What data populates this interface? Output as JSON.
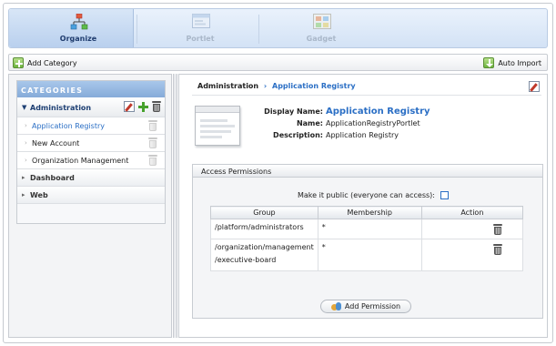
{
  "tabs": [
    {
      "label": "Organize",
      "icon": "organize-icon",
      "active": true
    },
    {
      "label": "Portlet",
      "icon": "portlet-icon",
      "active": false
    },
    {
      "label": "Gadget",
      "icon": "gadget-icon",
      "active": false
    }
  ],
  "toolbar": {
    "add_category": "Add Category",
    "auto_import": "Auto Import"
  },
  "sidebar": {
    "title": "CATEGORIES",
    "categories": [
      {
        "label": "Administration",
        "expanded": true,
        "items": [
          {
            "label": "Application Registry",
            "active": true
          },
          {
            "label": "New Account",
            "active": false
          },
          {
            "label": "Organization Management",
            "active": false
          }
        ]
      },
      {
        "label": "Dashboard",
        "expanded": false
      },
      {
        "label": "Web",
        "expanded": false
      }
    ]
  },
  "breadcrumb": {
    "parent": "Administration",
    "separator": "›",
    "current": "Application Registry"
  },
  "details": {
    "display_name_label": "Display Name:",
    "display_name": "Application Registry",
    "name_label": "Name:",
    "name": "ApplicationRegistryPortlet",
    "description_label": "Description:",
    "description": "Application Registry"
  },
  "permissions": {
    "title": "Access Permissions",
    "public_label": "Make it public (everyone can access):",
    "public_checked": false,
    "columns": [
      "Group",
      "Membership",
      "Action"
    ],
    "rows": [
      {
        "group_line1": "/platform/administrators",
        "group_line2": "",
        "membership": "*"
      },
      {
        "group_line1": "/organization/management",
        "group_line2": "/executive-board",
        "membership": "*"
      }
    ],
    "add_button": "Add Permission"
  },
  "colors": {
    "accent": "#2b6fc5",
    "header_blue": "#86abd9",
    "nav_title": "#1f3c6e"
  }
}
